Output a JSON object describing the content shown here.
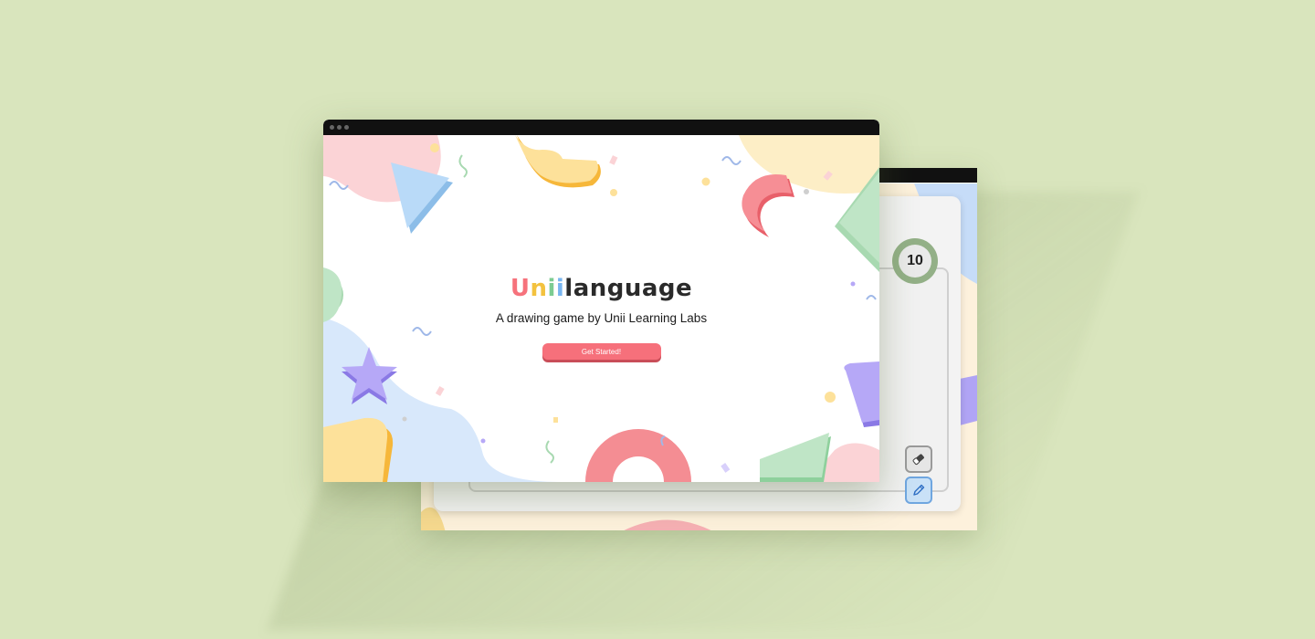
{
  "front": {
    "logo": {
      "u": "U",
      "n": "n",
      "i1": "i",
      "i2": "i",
      "rest": "language"
    },
    "tagline": "A drawing game by Unii Learning Labs",
    "cta_label": "Get Started!"
  },
  "back": {
    "timer_value": "10",
    "tools": [
      "eraser-icon",
      "pencil-icon"
    ]
  },
  "colors": {
    "background": "#d9e5bd",
    "accent_red": "#f6707b",
    "yellow": "#f3c23f",
    "green": "#7ccc92",
    "blue": "#78b5f0",
    "purple": "#b0a4f5"
  }
}
